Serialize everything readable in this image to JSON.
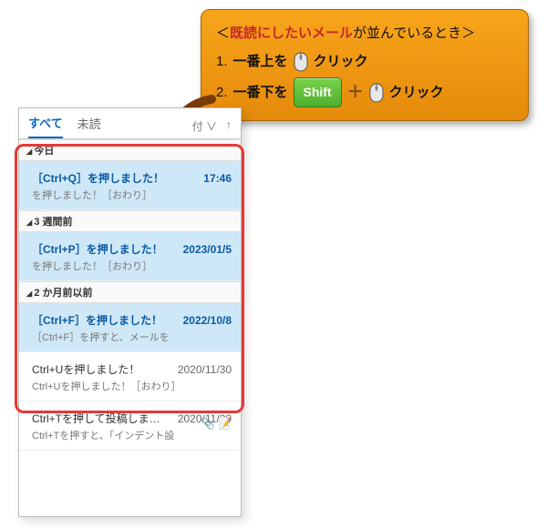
{
  "callout": {
    "title_pre": "＜",
    "title_highlight": "既読にしたいメール",
    "title_post": "が並んでいるとき＞",
    "step1_num": "1.",
    "step1_bold": "一番上を",
    "click_label": "クリック",
    "step2_num": "2.",
    "step2_bold": "一番下を",
    "shift_label": "Shift"
  },
  "tabs": {
    "all": "すべて",
    "unread": "未読",
    "sort": "付 ∨",
    "up": "↑"
  },
  "groups": [
    {
      "label": "今日"
    },
    {
      "label": "3 週間前"
    },
    {
      "label": "2 か月前以前"
    }
  ],
  "mails": [
    {
      "subject": "［Ctrl+Q］を押しました！",
      "date": "17:46",
      "preview": "を押しました！［おわり］",
      "selected": true
    },
    {
      "subject": "［Ctrl+P］を押しました！",
      "date": "2023/01/5",
      "preview": "を押しました！［おわり］",
      "selected": true
    },
    {
      "subject": "［Ctrl+F］を押しました！",
      "date": "2022/10/8",
      "preview": "［Ctrl+F］を押すと、メールを",
      "selected": true
    },
    {
      "subject": "Ctrl+Uを押しました！",
      "date": "2020/11/30",
      "preview": "Ctrl+Uを押しました！［おわり］",
      "selected": false
    },
    {
      "subject": "Ctrl+Tを押して投稿します！",
      "date": "2020/11/20",
      "preview": "Ctrl+Tを押すと、「インデント設",
      "selected": false,
      "attach": true
    }
  ]
}
